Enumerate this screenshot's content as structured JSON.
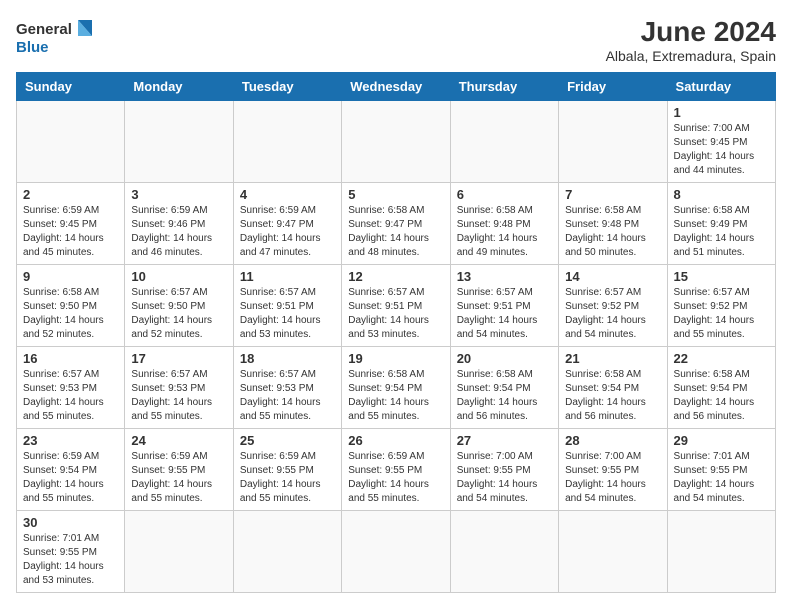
{
  "header": {
    "logo_line1": "General",
    "logo_line2": "Blue",
    "month_year": "June 2024",
    "location": "Albala, Extremadura, Spain"
  },
  "weekdays": [
    "Sunday",
    "Monday",
    "Tuesday",
    "Wednesday",
    "Thursday",
    "Friday",
    "Saturday"
  ],
  "weeks": [
    [
      {
        "day": "",
        "info": ""
      },
      {
        "day": "",
        "info": ""
      },
      {
        "day": "",
        "info": ""
      },
      {
        "day": "",
        "info": ""
      },
      {
        "day": "",
        "info": ""
      },
      {
        "day": "",
        "info": ""
      },
      {
        "day": "1",
        "info": "Sunrise: 7:00 AM\nSunset: 9:45 PM\nDaylight: 14 hours\nand 44 minutes."
      }
    ],
    [
      {
        "day": "2",
        "info": "Sunrise: 6:59 AM\nSunset: 9:45 PM\nDaylight: 14 hours\nand 45 minutes."
      },
      {
        "day": "3",
        "info": "Sunrise: 6:59 AM\nSunset: 9:46 PM\nDaylight: 14 hours\nand 46 minutes."
      },
      {
        "day": "4",
        "info": "Sunrise: 6:59 AM\nSunset: 9:47 PM\nDaylight: 14 hours\nand 47 minutes."
      },
      {
        "day": "5",
        "info": "Sunrise: 6:58 AM\nSunset: 9:47 PM\nDaylight: 14 hours\nand 48 minutes."
      },
      {
        "day": "6",
        "info": "Sunrise: 6:58 AM\nSunset: 9:48 PM\nDaylight: 14 hours\nand 49 minutes."
      },
      {
        "day": "7",
        "info": "Sunrise: 6:58 AM\nSunset: 9:48 PM\nDaylight: 14 hours\nand 50 minutes."
      },
      {
        "day": "8",
        "info": "Sunrise: 6:58 AM\nSunset: 9:49 PM\nDaylight: 14 hours\nand 51 minutes."
      }
    ],
    [
      {
        "day": "9",
        "info": "Sunrise: 6:58 AM\nSunset: 9:50 PM\nDaylight: 14 hours\nand 52 minutes."
      },
      {
        "day": "10",
        "info": "Sunrise: 6:57 AM\nSunset: 9:50 PM\nDaylight: 14 hours\nand 52 minutes."
      },
      {
        "day": "11",
        "info": "Sunrise: 6:57 AM\nSunset: 9:51 PM\nDaylight: 14 hours\nand 53 minutes."
      },
      {
        "day": "12",
        "info": "Sunrise: 6:57 AM\nSunset: 9:51 PM\nDaylight: 14 hours\nand 53 minutes."
      },
      {
        "day": "13",
        "info": "Sunrise: 6:57 AM\nSunset: 9:51 PM\nDaylight: 14 hours\nand 54 minutes."
      },
      {
        "day": "14",
        "info": "Sunrise: 6:57 AM\nSunset: 9:52 PM\nDaylight: 14 hours\nand 54 minutes."
      },
      {
        "day": "15",
        "info": "Sunrise: 6:57 AM\nSunset: 9:52 PM\nDaylight: 14 hours\nand 55 minutes."
      }
    ],
    [
      {
        "day": "16",
        "info": "Sunrise: 6:57 AM\nSunset: 9:53 PM\nDaylight: 14 hours\nand 55 minutes."
      },
      {
        "day": "17",
        "info": "Sunrise: 6:57 AM\nSunset: 9:53 PM\nDaylight: 14 hours\nand 55 minutes."
      },
      {
        "day": "18",
        "info": "Sunrise: 6:57 AM\nSunset: 9:53 PM\nDaylight: 14 hours\nand 55 minutes."
      },
      {
        "day": "19",
        "info": "Sunrise: 6:58 AM\nSunset: 9:54 PM\nDaylight: 14 hours\nand 55 minutes."
      },
      {
        "day": "20",
        "info": "Sunrise: 6:58 AM\nSunset: 9:54 PM\nDaylight: 14 hours\nand 56 minutes."
      },
      {
        "day": "21",
        "info": "Sunrise: 6:58 AM\nSunset: 9:54 PM\nDaylight: 14 hours\nand 56 minutes."
      },
      {
        "day": "22",
        "info": "Sunrise: 6:58 AM\nSunset: 9:54 PM\nDaylight: 14 hours\nand 56 minutes."
      }
    ],
    [
      {
        "day": "23",
        "info": "Sunrise: 6:59 AM\nSunset: 9:54 PM\nDaylight: 14 hours\nand 55 minutes."
      },
      {
        "day": "24",
        "info": "Sunrise: 6:59 AM\nSunset: 9:55 PM\nDaylight: 14 hours\nand 55 minutes."
      },
      {
        "day": "25",
        "info": "Sunrise: 6:59 AM\nSunset: 9:55 PM\nDaylight: 14 hours\nand 55 minutes."
      },
      {
        "day": "26",
        "info": "Sunrise: 6:59 AM\nSunset: 9:55 PM\nDaylight: 14 hours\nand 55 minutes."
      },
      {
        "day": "27",
        "info": "Sunrise: 7:00 AM\nSunset: 9:55 PM\nDaylight: 14 hours\nand 54 minutes."
      },
      {
        "day": "28",
        "info": "Sunrise: 7:00 AM\nSunset: 9:55 PM\nDaylight: 14 hours\nand 54 minutes."
      },
      {
        "day": "29",
        "info": "Sunrise: 7:01 AM\nSunset: 9:55 PM\nDaylight: 14 hours\nand 54 minutes."
      }
    ],
    [
      {
        "day": "30",
        "info": "Sunrise: 7:01 AM\nSunset: 9:55 PM\nDaylight: 14 hours\nand 53 minutes."
      },
      {
        "day": "",
        "info": ""
      },
      {
        "day": "",
        "info": ""
      },
      {
        "day": "",
        "info": ""
      },
      {
        "day": "",
        "info": ""
      },
      {
        "day": "",
        "info": ""
      },
      {
        "day": "",
        "info": ""
      }
    ]
  ]
}
